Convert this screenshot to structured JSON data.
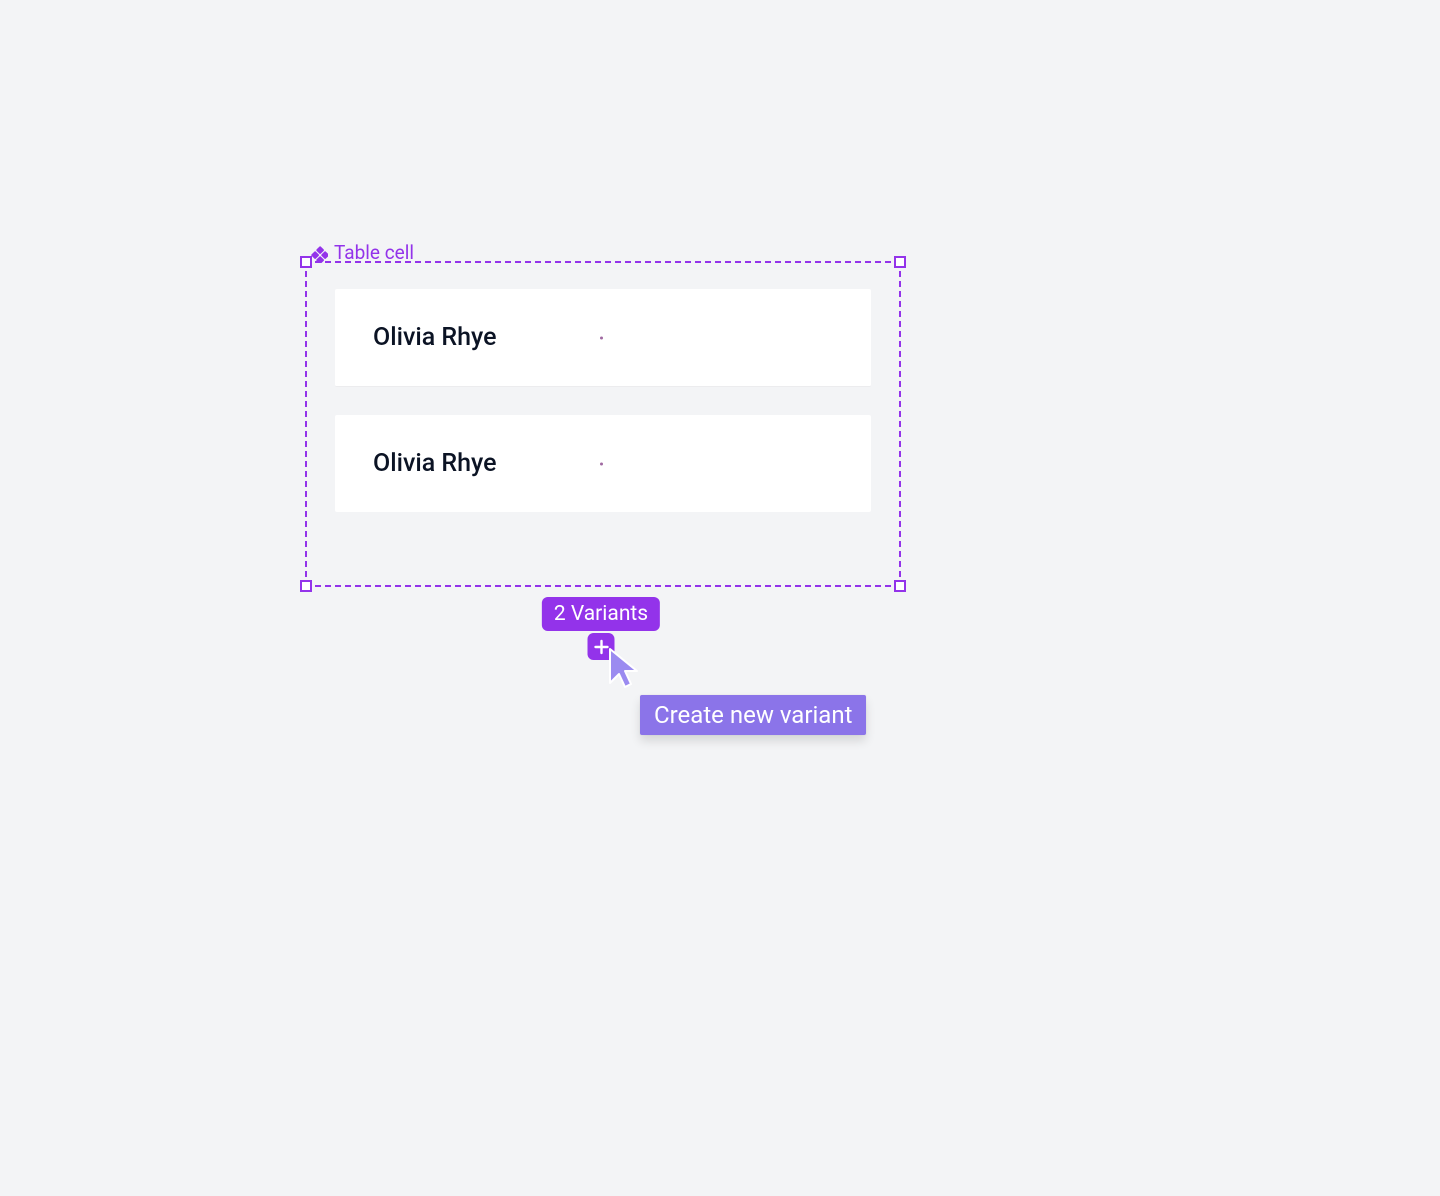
{
  "component": {
    "label": "Table cell"
  },
  "variants": [
    {
      "name": "Olivia Rhye"
    },
    {
      "name": "Olivia Rhye"
    }
  ],
  "badge": {
    "label": "2 Variants"
  },
  "tooltip": {
    "label": "Create new variant"
  },
  "colors": {
    "accent": "#9333ea",
    "accent_soft": "#8b74e9",
    "canvas": "#f3f4f6"
  }
}
